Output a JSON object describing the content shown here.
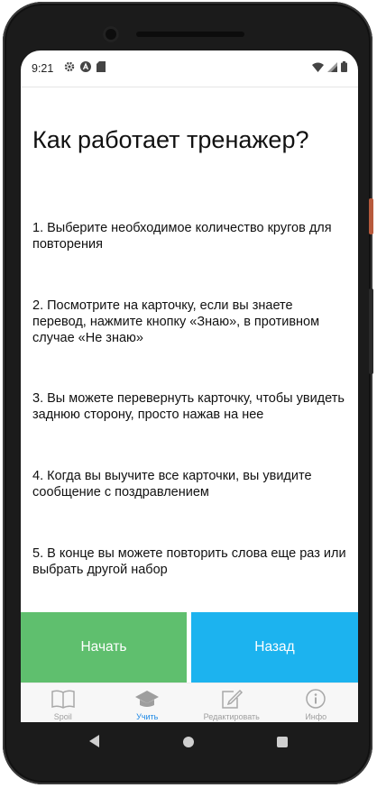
{
  "status": {
    "time": "9:21",
    "icons_left": [
      "gear-icon",
      "a-badge-icon",
      "sd-card-icon"
    ],
    "icons_right": [
      "wifi-icon",
      "signal-icon",
      "battery-icon"
    ]
  },
  "page": {
    "title": "Как работает тренажер?",
    "steps": [
      "1. Выберите необходимое количество кругов для повторения",
      "2. Посмотрите на карточку, если вы знаете перевод, нажмите кнопку «Знаю», в противном случае «Не знаю»",
      "3. Вы можете перевернуть карточку, чтобы увидеть заднюю сторону, просто нажав на нее",
      "4. Когда вы выучите все карточки, вы увидите сообщение с поздравлением",
      "5. В конце вы можете повторить слова еще раз или выбрать другой набор"
    ]
  },
  "buttons": {
    "start": "Начать",
    "back": "Назад",
    "start_color": "#5fbf6e",
    "back_color": "#1cb3ef"
  },
  "tabs": [
    {
      "label": "Spoil",
      "icon": "book-icon",
      "active": false
    },
    {
      "label": "Учить",
      "icon": "graduation-cap-icon",
      "active": true
    },
    {
      "label": "Редактировать",
      "icon": "edit-icon",
      "active": false
    },
    {
      "label": "Инфо",
      "icon": "info-icon",
      "active": false
    }
  ],
  "colors": {
    "active_tab": "#1e88e5",
    "inactive_tab": "#9e9e9e"
  }
}
